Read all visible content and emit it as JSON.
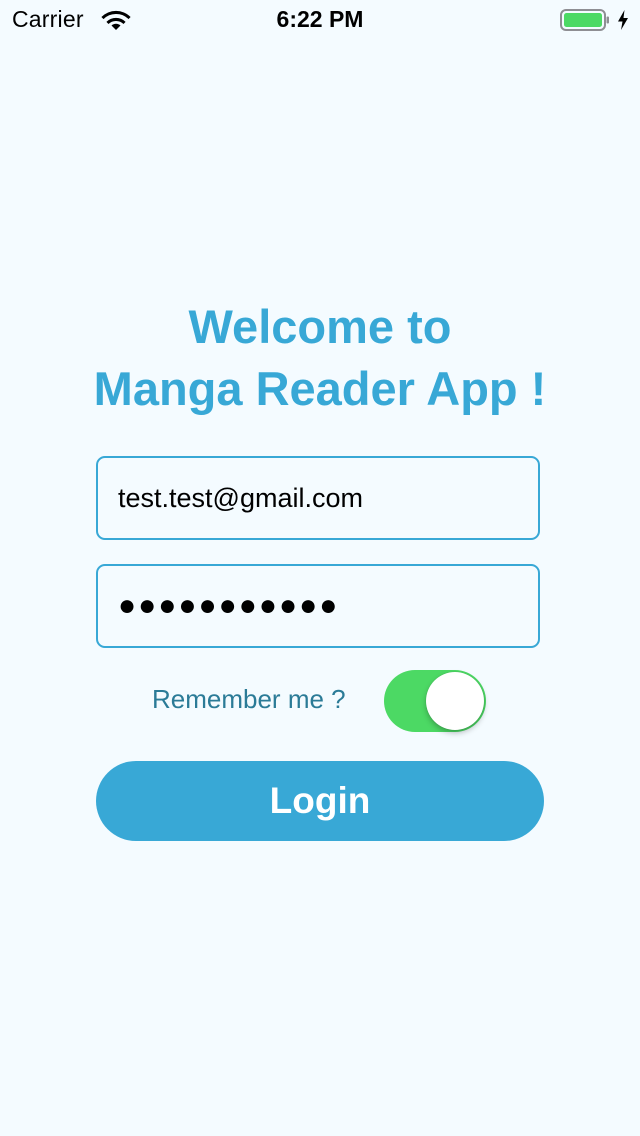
{
  "status_bar": {
    "carrier": "Carrier",
    "time": "6:22 PM",
    "battery_level": 1.0,
    "charging": true,
    "colors": {
      "battery": "#4cd964"
    }
  },
  "welcome": {
    "line1": "Welcome to",
    "line2": "Manga Reader App !"
  },
  "login_form": {
    "email_value": "test.test@gmail.com",
    "password_value": "●●●●●●●●●●●",
    "remember_label": "Remember me ?",
    "remember_checked": true,
    "login_label": "Login"
  },
  "colors": {
    "accent": "#38a8d6",
    "background": "#f4fbff",
    "switch_on": "#4cd964",
    "label": "#2b7b97"
  }
}
